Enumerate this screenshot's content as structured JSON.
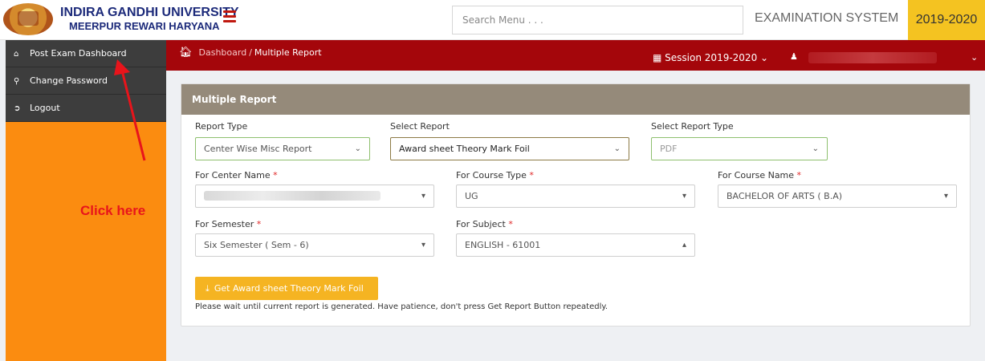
{
  "header": {
    "university_name": "INDIRA GANDHI UNIVERSITY",
    "university_place": "MEERPUR REWARI HARYANA",
    "search_placeholder": "Search Menu . . .",
    "system_title": "EXAMINATION SYSTEM",
    "year_badge": "2019-2020"
  },
  "sidebar": {
    "items": [
      {
        "label": "Post Exam Dashboard",
        "icon": "home-icon"
      },
      {
        "label": "Change Password",
        "icon": "key-icon"
      },
      {
        "label": "Logout",
        "icon": "logout-icon"
      }
    ],
    "annotation": "Click here"
  },
  "topbar": {
    "breadcrumb_root": "Dashboard",
    "breadcrumb_separator": "/",
    "breadcrumb_current": "Multiple Report",
    "session_label": "Session",
    "session_value": "2019-2020"
  },
  "form": {
    "title": "Multiple Report",
    "report_type": {
      "label": "Report Type",
      "value": "Center Wise Misc Report"
    },
    "select_report": {
      "label": "Select Report",
      "value": "Award sheet Theory Mark Foil"
    },
    "select_report_type": {
      "label": "Select Report Type",
      "value": "PDF"
    },
    "center_name": {
      "label": "For Center Name",
      "required": "*"
    },
    "course_type": {
      "label": "For Course Type",
      "required": "*",
      "value": "UG"
    },
    "course_name": {
      "label": "For Course Name",
      "required": "*",
      "value": "BACHELOR OF ARTS ( B.A)"
    },
    "semester": {
      "label": "For Semester",
      "required": "*",
      "value": "Six Semester ( Sem - 6)"
    },
    "subject": {
      "label": "For Subject",
      "required": "*",
      "value": "ENGLISH - 61001"
    },
    "submit_label": "Get Award sheet Theory Mark Foil",
    "wait_note": "Please wait until current report is generated. Have patience, don't press Get Report Button repeatedly."
  },
  "colors": {
    "sidebar_bg": "#fb8c10",
    "header_strip": "#a4060b",
    "year_badge": "#f4c321",
    "panel_head": "#958a7a",
    "button": "#f5b422",
    "annotation": "#e8141b"
  }
}
